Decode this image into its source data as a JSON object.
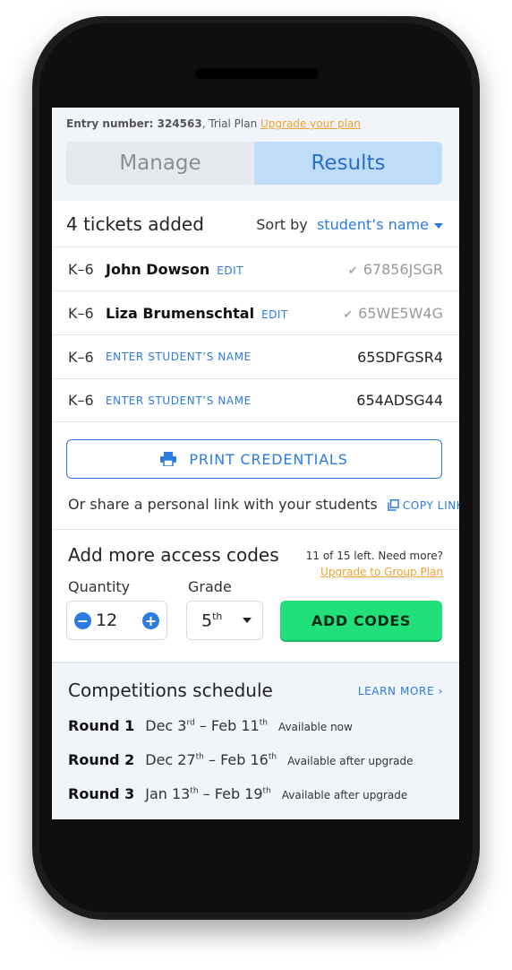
{
  "header": {
    "entry_label": "Entry number: 324563",
    "plan_text": ", Trial Plan",
    "upgrade_link": "Upgrade your plan"
  },
  "tabs": [
    {
      "label": "Manage",
      "active": false
    },
    {
      "label": "Results",
      "active": true
    }
  ],
  "tickets": {
    "count_label": "4 tickets added",
    "sort_label": "Sort by",
    "sort_value": "student’s name",
    "rows": [
      {
        "grade": "K–6",
        "name": "John Dowson",
        "action": "EDIT",
        "code": "67856JSGR",
        "verified": true
      },
      {
        "grade": "K–6",
        "name": "Liza Brumenschtal",
        "action": "EDIT",
        "code": "65WE5W4G",
        "verified": true
      },
      {
        "grade": "K–6",
        "name": "",
        "action": "ENTER STUDENT’S NAME",
        "code": "65SDFGSR4",
        "verified": false
      },
      {
        "grade": "K–6",
        "name": "",
        "action": "ENTER STUDENT’S NAME",
        "code": "654ADSG44",
        "verified": false
      }
    ]
  },
  "print_label": "PRINT CREDENTIALS",
  "share": {
    "text": "Or share a personal link with your students",
    "copy_label": "COPY LINK"
  },
  "add_codes": {
    "title": "Add more access codes",
    "remaining": "11 of 15 left. Need more?",
    "upgrade_link": "Upgrade to Group Plan",
    "quantity_label": "Quantity",
    "quantity_value": "12",
    "grade_label": "Grade",
    "grade_value": "5",
    "grade_suffix": "th",
    "button_label": "ADD CODES"
  },
  "schedule": {
    "title": "Competitions schedule",
    "learn_more": "LEARN MORE",
    "rounds": [
      {
        "name": "Round 1",
        "start": "Dec 3",
        "start_sup": "rd",
        "end": " – Feb 11",
        "end_sup": "th",
        "status": "Available now"
      },
      {
        "name": "Round 2",
        "start": "Dec 27",
        "start_sup": "th",
        "end": " – Feb 16",
        "end_sup": "th",
        "status": "Available after upgrade"
      },
      {
        "name": "Round 3",
        "start": "Jan 13",
        "start_sup": "th",
        "end": " – Feb 19",
        "end_sup": "th",
        "status": "Available after upgrade"
      }
    ]
  },
  "colors": {
    "accent": "#2a7be4",
    "upgrade": "#f0a030",
    "add_button": "#21e07a",
    "active_tab": "#bfdcf9"
  }
}
